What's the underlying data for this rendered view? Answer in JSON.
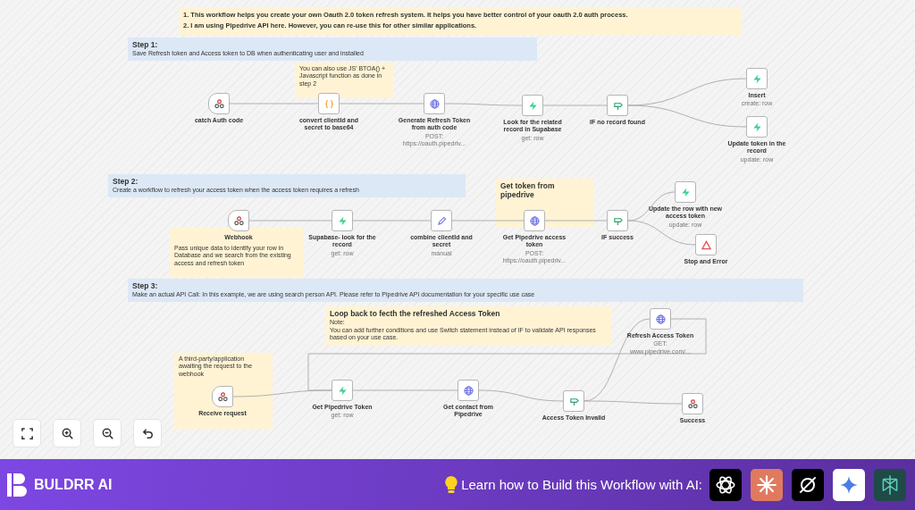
{
  "canvas": {
    "notes": [
      {
        "color": "#fff3d4",
        "lines": [
          "1. This workflow helps you create your own Oauth 2.0 token refresh system. It helps you have better control of your oauth 2.0 auth process.",
          "2. I am using Pipedrive API here. However, you can re-use this for other similar applications."
        ]
      },
      {
        "color": "#dde8f6",
        "title": "Step 1:",
        "lines": [
          "Save Refresh token and Access token to DB when authenticating user and installed"
        ]
      },
      {
        "color": "#fff3d4",
        "lines": [
          "You can also use JS' BTOA() + Javascript function as done in step 2"
        ]
      },
      {
        "color": "#dde8f6",
        "title": "Step 2:",
        "lines": [
          "Create a workflow to refresh your access token when the access token requires a refresh"
        ]
      },
      {
        "color": "#fff3d4",
        "lines": [
          "Pass unique data to identify your row in Database and we search from the existing access and refresh token"
        ]
      },
      {
        "color": "#fff3d4",
        "title": "Get token from pipedrive"
      },
      {
        "color": "#dde8f6",
        "title": "Step 3:",
        "lines": [
          "Make an actual API Call: In this example, we are using search person API. Please refer to Pipedrive API documentation for your specific use case"
        ]
      },
      {
        "color": "#fff3d4",
        "title": "Loop back to fecth the refreshed Access Token",
        "lines": [
          "Note:",
          "You can add further conditions and use Switch statement instead of IF to validate API responses based on your use case."
        ]
      },
      {
        "color": "#fff3d4",
        "lines": [
          "A third-party/application awaiting the request to the webhook"
        ]
      }
    ],
    "nodes": [
      {
        "kind": "webhook",
        "label": "catch Auth code"
      },
      {
        "kind": "code",
        "label": "convert clientId and secret to base64"
      },
      {
        "kind": "http",
        "label": "Generate Refresh Token from auth code",
        "subtitle": "POST: https://oauth.pipedriv..."
      },
      {
        "kind": "supabase",
        "label": "Look for the related record in Supabase",
        "subtitle": "get: row"
      },
      {
        "kind": "if",
        "label": "IF no record found"
      },
      {
        "kind": "supabase",
        "label": "Insert",
        "subtitle": "create: row"
      },
      {
        "kind": "supabase",
        "label": "Update token in the record",
        "subtitle": "update: row"
      },
      {
        "kind": "webhook",
        "label": "Webhook"
      },
      {
        "kind": "supabase",
        "label": "Supabase- look for the record",
        "subtitle": "get: row"
      },
      {
        "kind": "set",
        "label": "combine clientId and secret",
        "subtitle": "manual"
      },
      {
        "kind": "http",
        "label": "Get Pipedrive access token",
        "subtitle": "POST: https://oauth.pipedriv..."
      },
      {
        "kind": "if",
        "label": "IF success"
      },
      {
        "kind": "supabase",
        "label": "Update the row with new access token",
        "subtitle": "update: row"
      },
      {
        "kind": "stop",
        "label": "Stop and Error"
      },
      {
        "kind": "webhook",
        "label": "Receive request"
      },
      {
        "kind": "supabase",
        "label": "Get Pipedrive Token",
        "subtitle": "get: row"
      },
      {
        "kind": "http",
        "label": "Get contact from Pipedrive"
      },
      {
        "kind": "if",
        "label": "Access Token Invalid"
      },
      {
        "kind": "http",
        "label": "Refresh Access Token",
        "subtitle": "GET: www.pipedrive.com/..."
      },
      {
        "kind": "respond",
        "label": "Success"
      }
    ]
  },
  "canvas_controls": [
    {
      "kind": "fit"
    },
    {
      "kind": "zoom-in"
    },
    {
      "kind": "zoom-out"
    },
    {
      "kind": "undo"
    }
  ],
  "footer": {
    "brand": "BULDRR AI",
    "cta": "Learn how to Build this Workflow with AI:",
    "ai_tools": [
      {
        "kind": "knot"
      },
      {
        "kind": "starburst"
      },
      {
        "kind": "slashed-circle"
      },
      {
        "kind": "sparkle"
      },
      {
        "kind": "lattice"
      }
    ]
  }
}
